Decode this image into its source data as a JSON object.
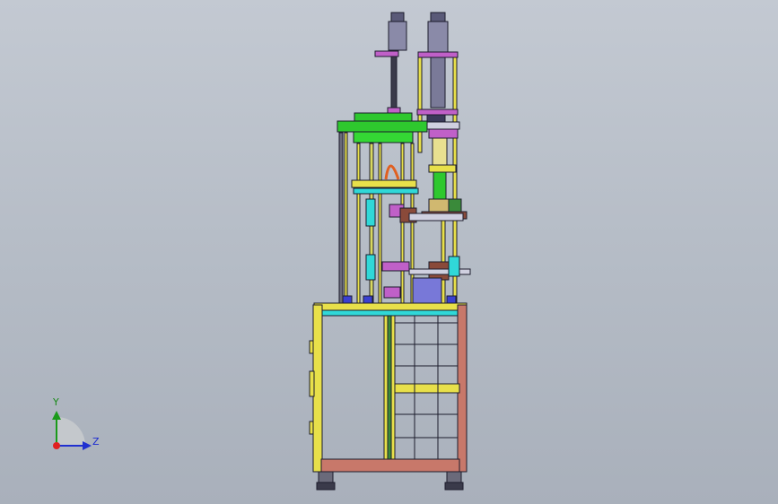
{
  "view": {
    "axis_labels": {
      "y": "Y",
      "z": "Z"
    },
    "colors": {
      "frame_yellow": "#e8e04a",
      "frame_red": "#c8786a",
      "plate_green": "#2ec82e",
      "cylinder_purple": "#c060c8",
      "cylinder_dark": "#5a5a78",
      "cyan_part": "#30d8d8",
      "blue_block": "#7878d8",
      "brown_part": "#8a4a3a",
      "outline": "#1c1c2c"
    }
  }
}
